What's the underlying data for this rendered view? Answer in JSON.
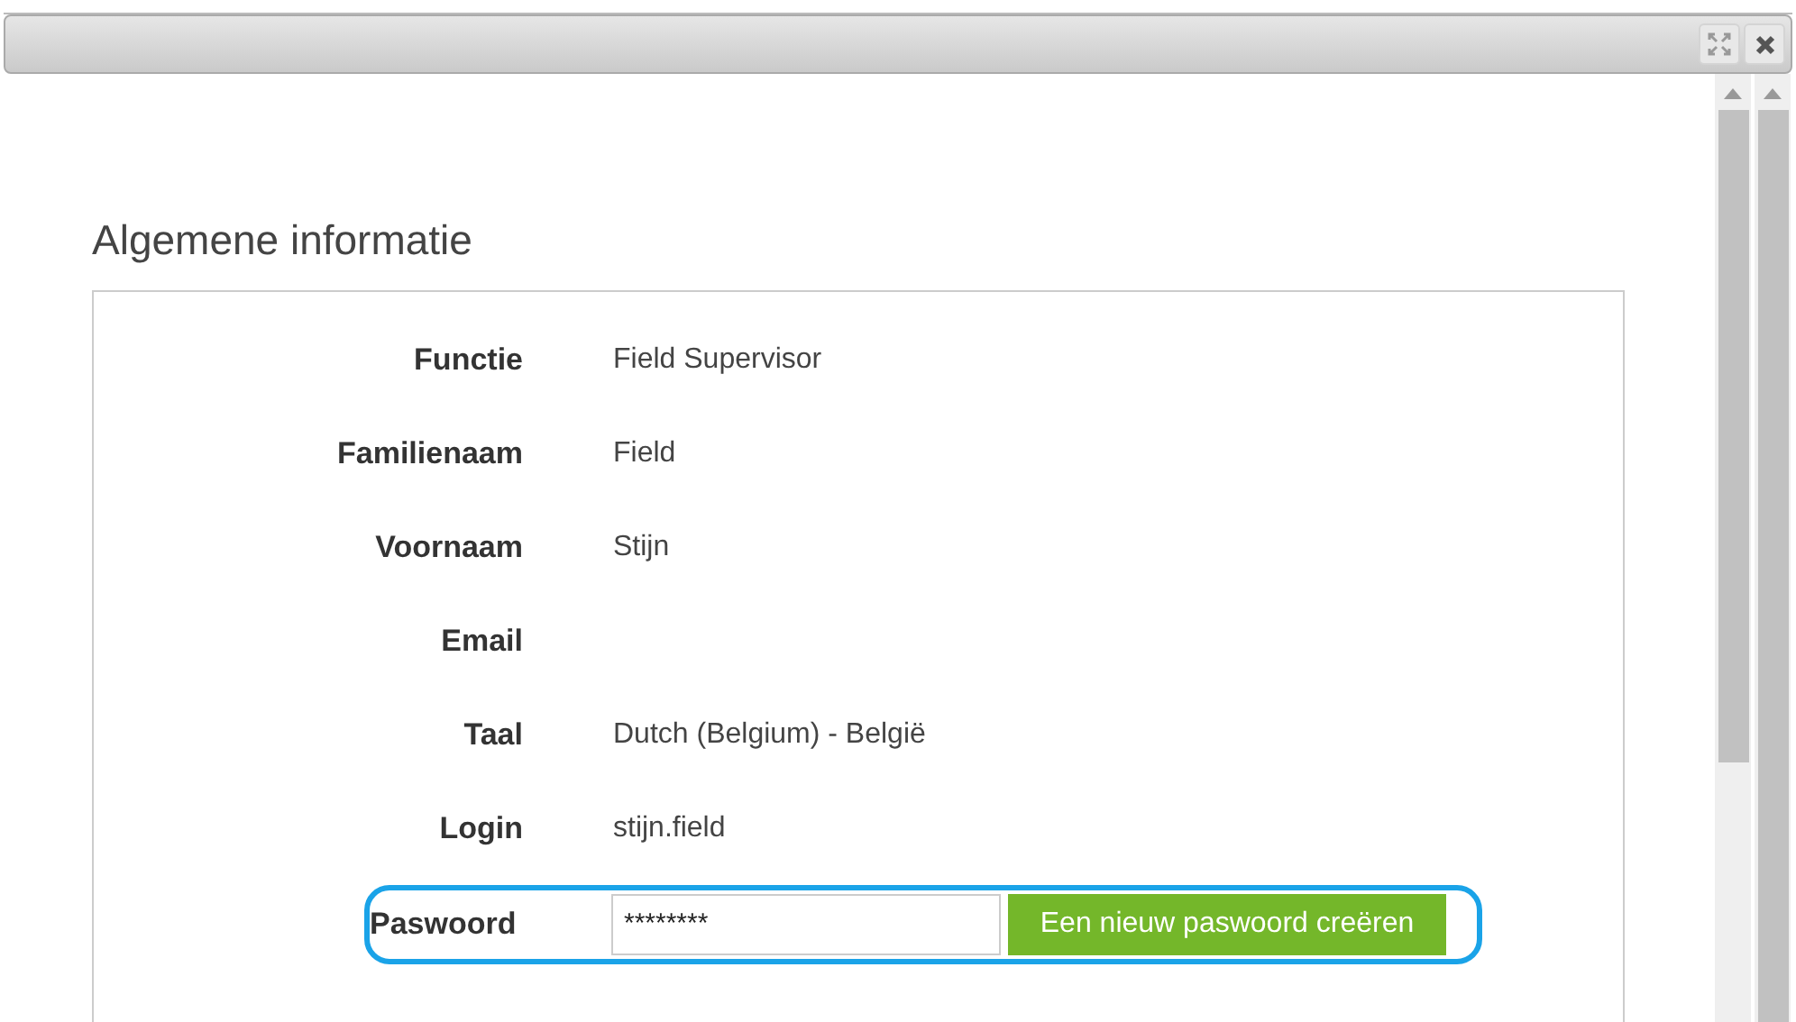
{
  "section": {
    "title": "Algemene informatie"
  },
  "fields": [
    {
      "label": "Functie",
      "value": "Field Supervisor"
    },
    {
      "label": "Familienaam",
      "value": "Field"
    },
    {
      "label": "Voornaam",
      "value": "Stijn"
    },
    {
      "label": "Email"
    },
    {
      "label": "Taal",
      "value": "Dutch (Belgium) - België"
    },
    {
      "label": "Login",
      "value": "stijn.field"
    }
  ],
  "password": {
    "label": "Paswoord",
    "value": "********",
    "button": "Een nieuw paswoord creëren",
    "highlighted": true
  }
}
